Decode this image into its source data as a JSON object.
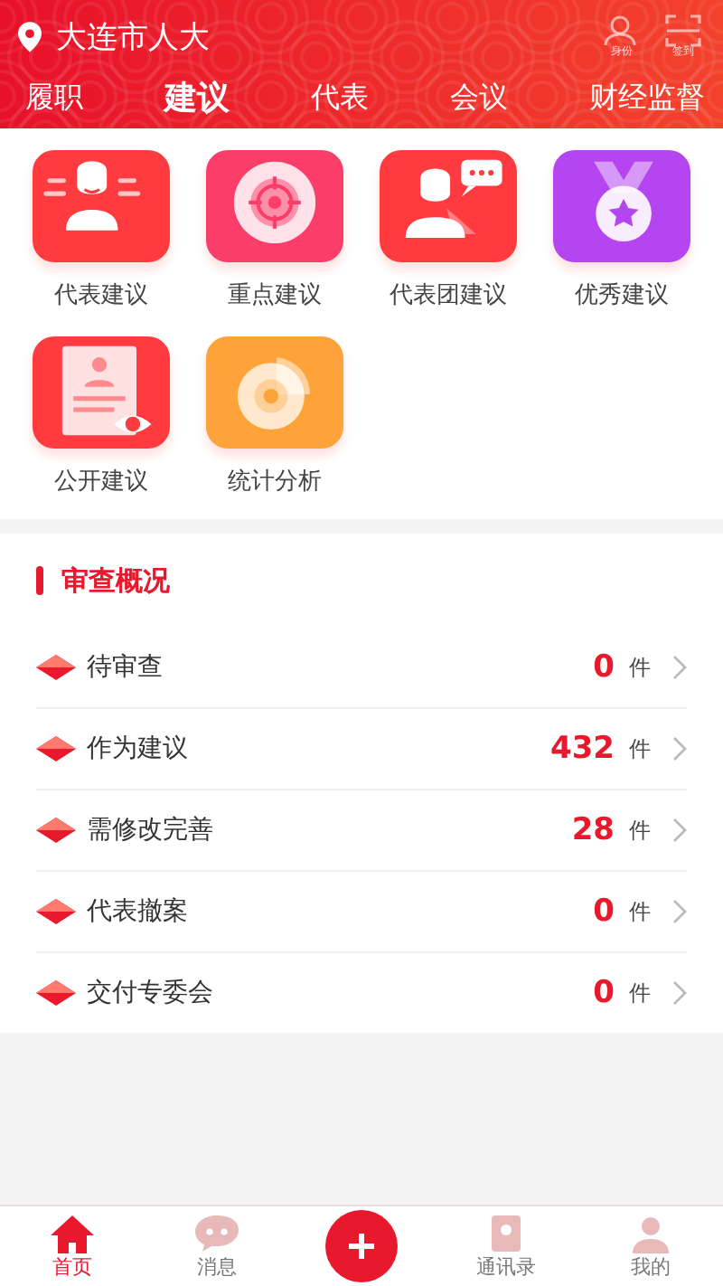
{
  "header": {
    "location": "大连市人大",
    "actions": [
      {
        "label": "身份",
        "kind": "person"
      },
      {
        "label": "签到",
        "kind": "scan"
      }
    ]
  },
  "tabs": [
    {
      "label": "履职",
      "selected": false
    },
    {
      "label": "建议",
      "selected": true
    },
    {
      "label": "代表",
      "selected": false
    },
    {
      "label": "会议",
      "selected": false
    },
    {
      "label": "财经监督",
      "selected": false
    }
  ],
  "features": [
    {
      "label": "代表建议",
      "kind": "speaker",
      "color": "#ff3b3f"
    },
    {
      "label": "重点建议",
      "kind": "target",
      "color": "#fb3d6a"
    },
    {
      "label": "代表团建议",
      "kind": "chat",
      "color": "#ff3b3f"
    },
    {
      "label": "优秀建议",
      "kind": "medal",
      "color": "#b545f0"
    },
    {
      "label": "公开建议",
      "kind": "document",
      "color": "#ff3b3f"
    },
    {
      "label": "统计分析",
      "kind": "chart",
      "color": "#fda33a"
    }
  ],
  "review": {
    "title": "审查概况",
    "rows": [
      {
        "label": "待审查",
        "count": "0",
        "unit": "件"
      },
      {
        "label": "作为建议",
        "count": "432",
        "unit": "件"
      },
      {
        "label": "需修改完善",
        "count": "28",
        "unit": "件"
      },
      {
        "label": "代表撤案",
        "count": "0",
        "unit": "件"
      },
      {
        "label": "交付专委会",
        "count": "0",
        "unit": "件"
      }
    ]
  },
  "bottom_nav": [
    {
      "label": "首页",
      "kind": "home",
      "selected": true
    },
    {
      "label": "消息",
      "kind": "message",
      "selected": false
    },
    {
      "kind": "add",
      "selected": false
    },
    {
      "label": "通讯录",
      "kind": "contacts",
      "selected": false
    },
    {
      "label": "我的",
      "kind": "profile",
      "selected": false
    }
  ]
}
